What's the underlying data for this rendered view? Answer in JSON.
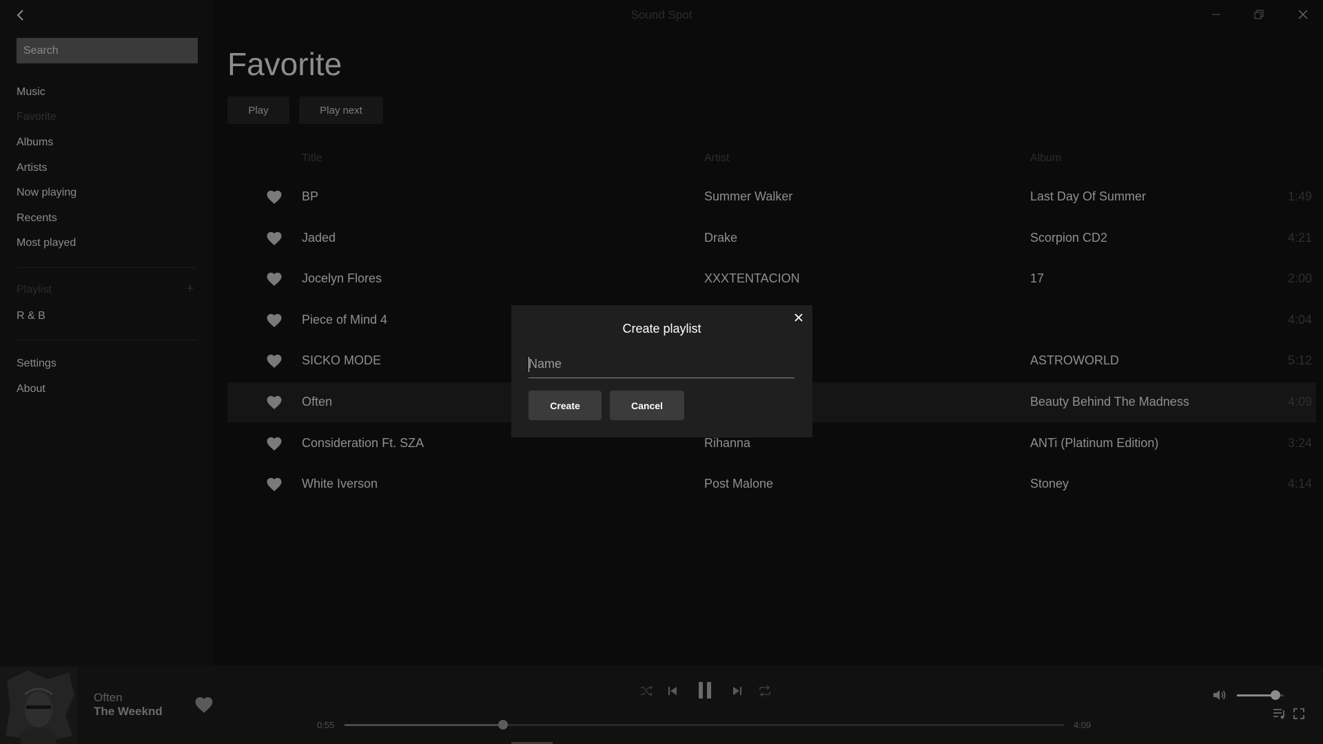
{
  "app": {
    "title": "Sound Spot"
  },
  "sidebar": {
    "search_placeholder": "Search",
    "nav": [
      {
        "label": "Music"
      },
      {
        "label": "Favorite"
      },
      {
        "label": "Albums"
      },
      {
        "label": "Artists"
      },
      {
        "label": "Now playing"
      },
      {
        "label": "Recents"
      },
      {
        "label": "Most played"
      }
    ],
    "playlist_header": "Playlist",
    "playlist_add": "+",
    "playlists": [
      {
        "label": "R & B"
      }
    ],
    "footer": [
      {
        "label": "Settings"
      },
      {
        "label": "About"
      }
    ]
  },
  "main": {
    "title": "Favorite",
    "play_label": "Play",
    "play_next_label": "Play next",
    "columns": {
      "title": "Title",
      "artist": "Artist",
      "album": "Album"
    },
    "tracks": [
      {
        "title": "BP",
        "artist": "Summer Walker",
        "album": "Last Day Of Summer",
        "duration": "1:49"
      },
      {
        "title": "Jaded",
        "artist": "Drake",
        "album": "Scorpion CD2",
        "duration": "4:21"
      },
      {
        "title": "Jocelyn Flores",
        "artist": "XXXTENTACION",
        "album": "17",
        "duration": "2:00"
      },
      {
        "title": "Piece of Mind 4",
        "artist": "",
        "album": "",
        "duration": "4:04"
      },
      {
        "title": "SICKO MODE",
        "artist": "",
        "album": "ASTROWORLD",
        "duration": "5:12"
      },
      {
        "title": "Often",
        "artist": "",
        "album": "Beauty Behind The Madness",
        "duration": "4:09"
      },
      {
        "title": "Consideration Ft. SZA",
        "artist": "Rihanna",
        "album": "ANTi (Platinum Edition)",
        "duration": "3:24"
      },
      {
        "title": "White Iverson",
        "artist": "Post Malone",
        "album": "Stoney",
        "duration": "4:14"
      }
    ]
  },
  "dialog": {
    "title": "Create playlist",
    "name_placeholder": "Name",
    "create_label": "Create",
    "cancel_label": "Cancel"
  },
  "player": {
    "title": "Often",
    "artist": "The Weeknd",
    "elapsed": "0:55",
    "total": "4:09",
    "progress_fraction": 0.22,
    "volume_fraction": 0.82
  },
  "colors": {
    "dialog_bg": "#1f1f1f",
    "button_bg": "#3b3b3b"
  },
  "icons": {
    "back": "chevron-left-icon",
    "minimize": "minimize-icon",
    "maximize": "restore-icon",
    "close": "close-icon",
    "heart": "heart-icon",
    "shuffle": "shuffle-icon",
    "previous": "skip-previous-icon",
    "pause": "pause-icon",
    "next": "skip-next-icon",
    "repeat": "repeat-icon",
    "volume": "volume-icon",
    "queue": "queue-icon",
    "fullscreen": "fullscreen-icon"
  }
}
